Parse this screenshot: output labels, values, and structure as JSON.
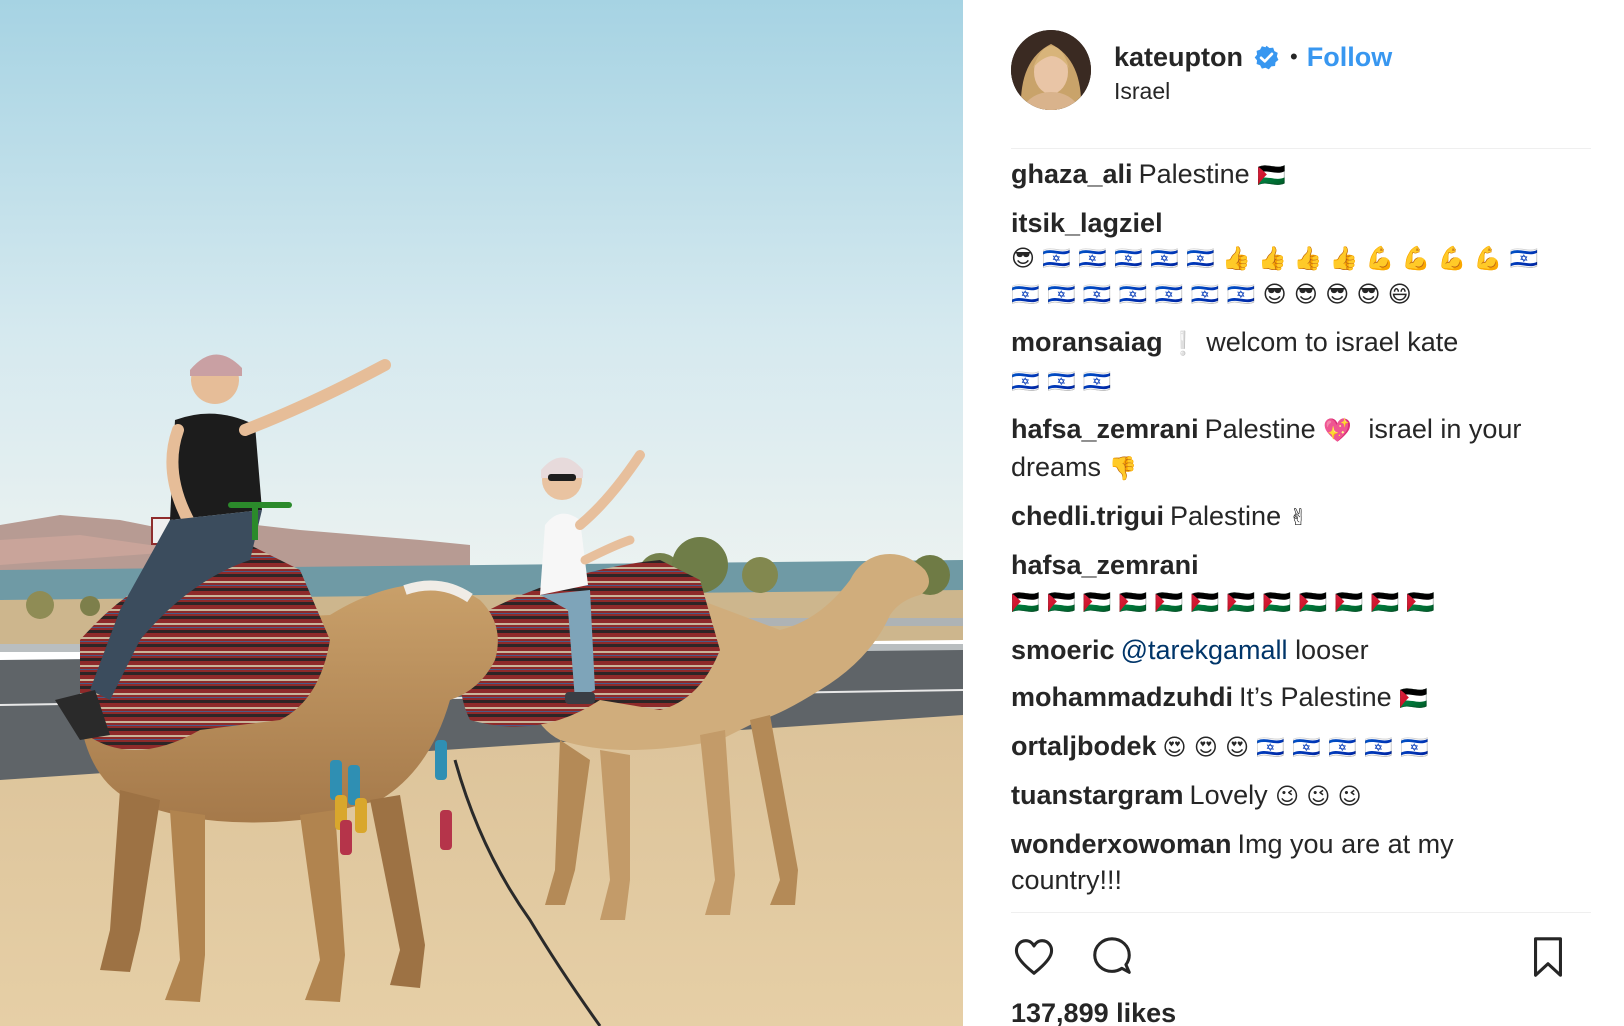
{
  "post": {
    "username": "kateupton",
    "separator": "•",
    "follow_label": "Follow",
    "location": "Israel",
    "likes": "137,899 likes"
  },
  "icons": {
    "avatar": "avatar-photo",
    "verified": "verified-badge-icon",
    "like": "heart-icon",
    "comment": "comment-bubble-icon",
    "save": "bookmark-icon"
  },
  "colors": {
    "accent": "#3897f0",
    "text": "#262626",
    "mention": "#003569",
    "divider": "#efefef"
  },
  "comments": [
    {
      "author": "ghaza_ali",
      "text": "Palestine",
      "emojis": "🇵🇸"
    },
    {
      "author": "itsik_lagziel",
      "text": "",
      "emojis": "😎 🇮🇱 🇮🇱 🇮🇱 🇮🇱 🇮🇱 👍 👍 👍 👍 💪 💪 💪 💪 🇮🇱 🇮🇱 🇮🇱 🇮🇱 🇮🇱 🇮🇱 🇮🇱 🇮🇱 😎 😎 😎 😎 😄"
    },
    {
      "author": "moransaiag",
      "text": "welcom to israel kate",
      "emojis_before": "❕",
      "emojis": "🇮🇱 🇮🇱 🇮🇱"
    },
    {
      "author": "hafsa_zemrani",
      "text": "Palestine",
      "emojis": "💖",
      "text2": "israel in your dreams",
      "emojis2": "👎"
    },
    {
      "author": "chedli.trigui",
      "text": "Palestine",
      "emojis": "✌"
    },
    {
      "author": "hafsa_zemrani",
      "text": "",
      "emojis": "🇵🇸 🇵🇸 🇵🇸 🇵🇸 🇵🇸 🇵🇸 🇵🇸 🇵🇸 🇵🇸 🇵🇸 🇵🇸 🇵🇸"
    },
    {
      "author": "smoeric",
      "mention": "@tarekgamall",
      "text": "looser",
      "emojis": ""
    },
    {
      "author": "mohammadzuhdi",
      "text": "It’s Palestine",
      "emojis": "🇵🇸"
    },
    {
      "author": "ortaljbodek",
      "text": "",
      "emojis": "😍 😍 😍 🇮🇱 🇮🇱 🇮🇱 🇮🇱 🇮🇱"
    },
    {
      "author": "tuanstargram",
      "text": "Lovely",
      "emojis": "😉 😉 😉"
    },
    {
      "author": "wonderxowoman",
      "text": "Img you are at my country!!!",
      "emojis": ""
    }
  ]
}
